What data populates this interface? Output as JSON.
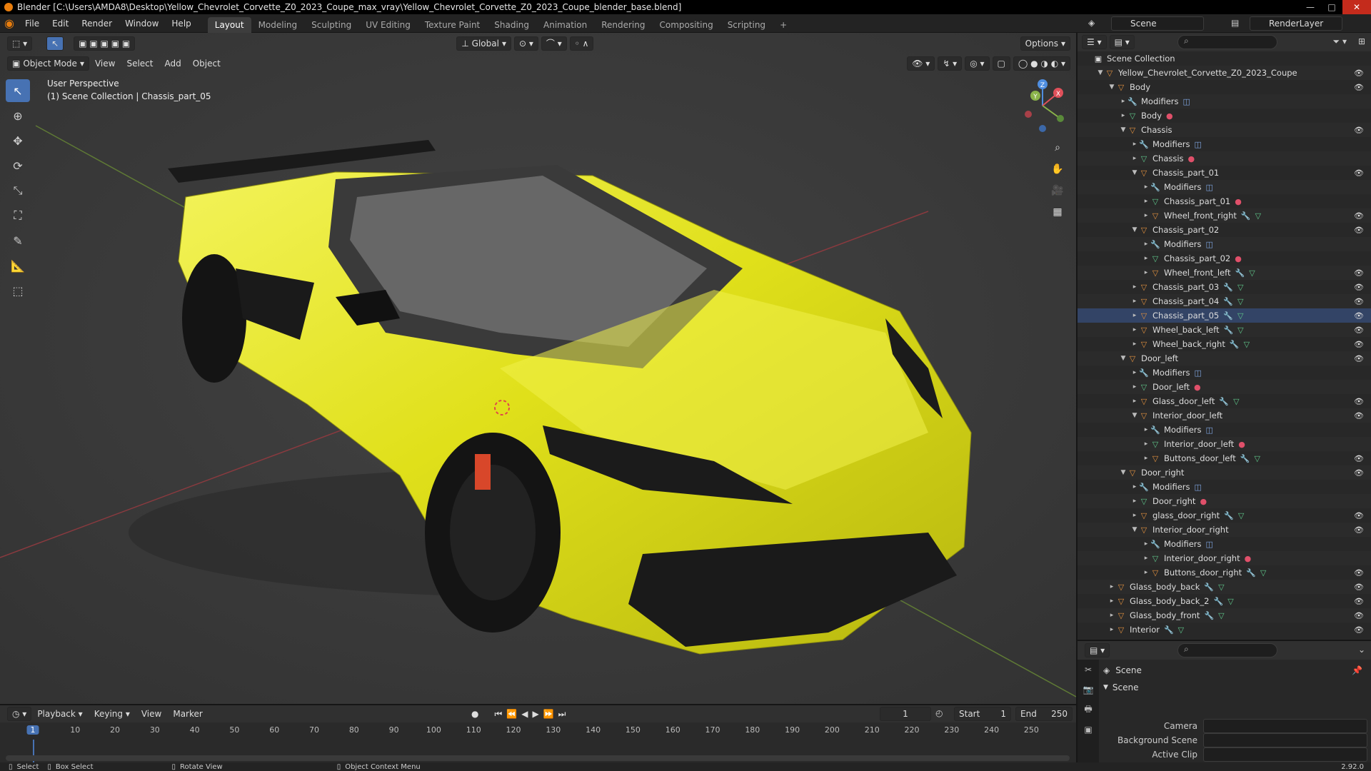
{
  "window": {
    "title": "Blender [C:\\Users\\AMDA8\\Desktop\\Yellow_Chevrolet_Corvette_Z0_2023_Coupe_max_vray\\Yellow_Chevrolet_Corvette_Z0_2023_Coupe_blender_base.blend]"
  },
  "menu": [
    "File",
    "Edit",
    "Render",
    "Window",
    "Help"
  ],
  "workspaces": [
    "Layout",
    "Modeling",
    "Sculpting",
    "UV Editing",
    "Texture Paint",
    "Shading",
    "Animation",
    "Rendering",
    "Compositing",
    "Scripting"
  ],
  "active_workspace": "Layout",
  "scene_field": "Scene",
  "renderlayer_field": "RenderLayer",
  "viewport": {
    "transform_orientation": "Global",
    "options_label": "Options",
    "mode": "Object Mode",
    "menus": [
      "View",
      "Select",
      "Add",
      "Object"
    ],
    "perspective_label": "User Perspective",
    "context_label": "(1) Scene Collection | Chassis_part_05"
  },
  "outliner": {
    "rows": [
      {
        "depth": 0,
        "arrow": "",
        "icon": "collection",
        "label": "Scene Collection",
        "extras": [],
        "eye": false
      },
      {
        "depth": 1,
        "arrow": "▼",
        "icon": "object",
        "label": "Yellow_Chevrolet_Corvette_Z0_2023_Coupe",
        "extras": [],
        "eye": true
      },
      {
        "depth": 2,
        "arrow": "▼",
        "icon": "object",
        "label": "Body",
        "extras": [],
        "eye": true
      },
      {
        "depth": 3,
        "arrow": "▸",
        "icon": "wrench",
        "label": "Modifiers",
        "extras": [
          "mod"
        ],
        "eye": false
      },
      {
        "depth": 3,
        "arrow": "▸",
        "icon": "mesh",
        "label": "Body",
        "extras": [
          "mat"
        ],
        "eye": false
      },
      {
        "depth": 3,
        "arrow": "▼",
        "icon": "object",
        "label": "Chassis",
        "extras": [],
        "eye": true
      },
      {
        "depth": 4,
        "arrow": "▸",
        "icon": "wrench",
        "label": "Modifiers",
        "extras": [
          "mod"
        ],
        "eye": false
      },
      {
        "depth": 4,
        "arrow": "▸",
        "icon": "mesh",
        "label": "Chassis",
        "extras": [
          "mat"
        ],
        "eye": false
      },
      {
        "depth": 4,
        "arrow": "▼",
        "icon": "object",
        "label": "Chassis_part_01",
        "extras": [],
        "eye": true
      },
      {
        "depth": 5,
        "arrow": "▸",
        "icon": "wrench",
        "label": "Modifiers",
        "extras": [
          "mod"
        ],
        "eye": false
      },
      {
        "depth": 5,
        "arrow": "▸",
        "icon": "mesh",
        "label": "Chassis_part_01",
        "extras": [
          "mat"
        ],
        "eye": false
      },
      {
        "depth": 5,
        "arrow": "▸",
        "icon": "object",
        "label": "Wheel_front_right",
        "extras": [
          "wr",
          "me"
        ],
        "eye": true
      },
      {
        "depth": 4,
        "arrow": "▼",
        "icon": "object",
        "label": "Chassis_part_02",
        "extras": [],
        "eye": true
      },
      {
        "depth": 5,
        "arrow": "▸",
        "icon": "wrench",
        "label": "Modifiers",
        "extras": [
          "mod"
        ],
        "eye": false
      },
      {
        "depth": 5,
        "arrow": "▸",
        "icon": "mesh",
        "label": "Chassis_part_02",
        "extras": [
          "mat"
        ],
        "eye": false
      },
      {
        "depth": 5,
        "arrow": "▸",
        "icon": "object",
        "label": "Wheel_front_left",
        "extras": [
          "wr",
          "me"
        ],
        "eye": true
      },
      {
        "depth": 4,
        "arrow": "▸",
        "icon": "object",
        "label": "Chassis_part_03",
        "extras": [
          "wr",
          "me"
        ],
        "eye": true
      },
      {
        "depth": 4,
        "arrow": "▸",
        "icon": "object",
        "label": "Chassis_part_04",
        "extras": [
          "wr",
          "me"
        ],
        "eye": true
      },
      {
        "depth": 4,
        "arrow": "▸",
        "icon": "object",
        "label": "Chassis_part_05",
        "extras": [
          "wr",
          "me"
        ],
        "eye": true
      },
      {
        "depth": 4,
        "arrow": "▸",
        "icon": "object",
        "label": "Wheel_back_left",
        "extras": [
          "wr",
          "me"
        ],
        "eye": true
      },
      {
        "depth": 4,
        "arrow": "▸",
        "icon": "object",
        "label": "Wheel_back_right",
        "extras": [
          "wr",
          "me"
        ],
        "eye": true
      },
      {
        "depth": 3,
        "arrow": "▼",
        "icon": "object",
        "label": "Door_left",
        "extras": [],
        "eye": true
      },
      {
        "depth": 4,
        "arrow": "▸",
        "icon": "wrench",
        "label": "Modifiers",
        "extras": [
          "mod"
        ],
        "eye": false
      },
      {
        "depth": 4,
        "arrow": "▸",
        "icon": "mesh",
        "label": "Door_left",
        "extras": [
          "mat"
        ],
        "eye": false
      },
      {
        "depth": 4,
        "arrow": "▸",
        "icon": "object",
        "label": "Glass_door_left",
        "extras": [
          "wr",
          "me"
        ],
        "eye": true
      },
      {
        "depth": 4,
        "arrow": "▼",
        "icon": "object",
        "label": "Interior_door_left",
        "extras": [],
        "eye": true
      },
      {
        "depth": 5,
        "arrow": "▸",
        "icon": "wrench",
        "label": "Modifiers",
        "extras": [
          "mod"
        ],
        "eye": false
      },
      {
        "depth": 5,
        "arrow": "▸",
        "icon": "mesh",
        "label": "Interior_door_left",
        "extras": [
          "mat"
        ],
        "eye": false
      },
      {
        "depth": 5,
        "arrow": "▸",
        "icon": "object",
        "label": "Buttons_door_left",
        "extras": [
          "wr",
          "me"
        ],
        "eye": true
      },
      {
        "depth": 3,
        "arrow": "▼",
        "icon": "object",
        "label": "Door_right",
        "extras": [],
        "eye": true
      },
      {
        "depth": 4,
        "arrow": "▸",
        "icon": "wrench",
        "label": "Modifiers",
        "extras": [
          "mod"
        ],
        "eye": false
      },
      {
        "depth": 4,
        "arrow": "▸",
        "icon": "mesh",
        "label": "Door_right",
        "extras": [
          "mat"
        ],
        "eye": false
      },
      {
        "depth": 4,
        "arrow": "▸",
        "icon": "object",
        "label": "glass_door_right",
        "extras": [
          "wr",
          "me"
        ],
        "eye": true
      },
      {
        "depth": 4,
        "arrow": "▼",
        "icon": "object",
        "label": "Interior_door_right",
        "extras": [],
        "eye": true
      },
      {
        "depth": 5,
        "arrow": "▸",
        "icon": "wrench",
        "label": "Modifiers",
        "extras": [
          "mod"
        ],
        "eye": false
      },
      {
        "depth": 5,
        "arrow": "▸",
        "icon": "mesh",
        "label": "Interior_door_right",
        "extras": [
          "mat"
        ],
        "eye": false
      },
      {
        "depth": 5,
        "arrow": "▸",
        "icon": "object",
        "label": "Buttons_door_right",
        "extras": [
          "wr",
          "me"
        ],
        "eye": true
      },
      {
        "depth": 2,
        "arrow": "▸",
        "icon": "object",
        "label": "Glass_body_back",
        "extras": [
          "wr",
          "me"
        ],
        "eye": true
      },
      {
        "depth": 2,
        "arrow": "▸",
        "icon": "object",
        "label": "Glass_body_back_2",
        "extras": [
          "wr",
          "me"
        ],
        "eye": true
      },
      {
        "depth": 2,
        "arrow": "▸",
        "icon": "object",
        "label": "Glass_body_front",
        "extras": [
          "wr",
          "me"
        ],
        "eye": true
      },
      {
        "depth": 2,
        "arrow": "▸",
        "icon": "object",
        "label": "Interior",
        "extras": [
          "wr",
          "me"
        ],
        "eye": true
      }
    ]
  },
  "properties": {
    "header": "Scene",
    "panel": "Scene",
    "rows": [
      {
        "label": "Camera",
        "value": ""
      },
      {
        "label": "Background Scene",
        "value": ""
      },
      {
        "label": "Active Clip",
        "value": ""
      }
    ]
  },
  "timeline": {
    "menus": [
      "Playback",
      "Keying",
      "View",
      "Marker"
    ],
    "current_frame": "1",
    "start_label": "Start",
    "start_value": "1",
    "end_label": "End",
    "end_value": "250",
    "ticks": [
      "1",
      "10",
      "20",
      "30",
      "40",
      "50",
      "60",
      "70",
      "80",
      "90",
      "100",
      "110",
      "120",
      "130",
      "140",
      "150",
      "160",
      "170",
      "180",
      "190",
      "200",
      "210",
      "220",
      "230",
      "240",
      "250"
    ]
  },
  "statusbar": {
    "items": [
      "Select",
      "Box Select",
      "Rotate View",
      "Object Context Menu"
    ],
    "version": "2.92.0"
  },
  "colors": {
    "accent": "#4772b3",
    "car_body": "#e5e51f",
    "x_axis": "#e0505a",
    "y_axis": "#8ab34a",
    "z_axis": "#4f8ee0"
  }
}
